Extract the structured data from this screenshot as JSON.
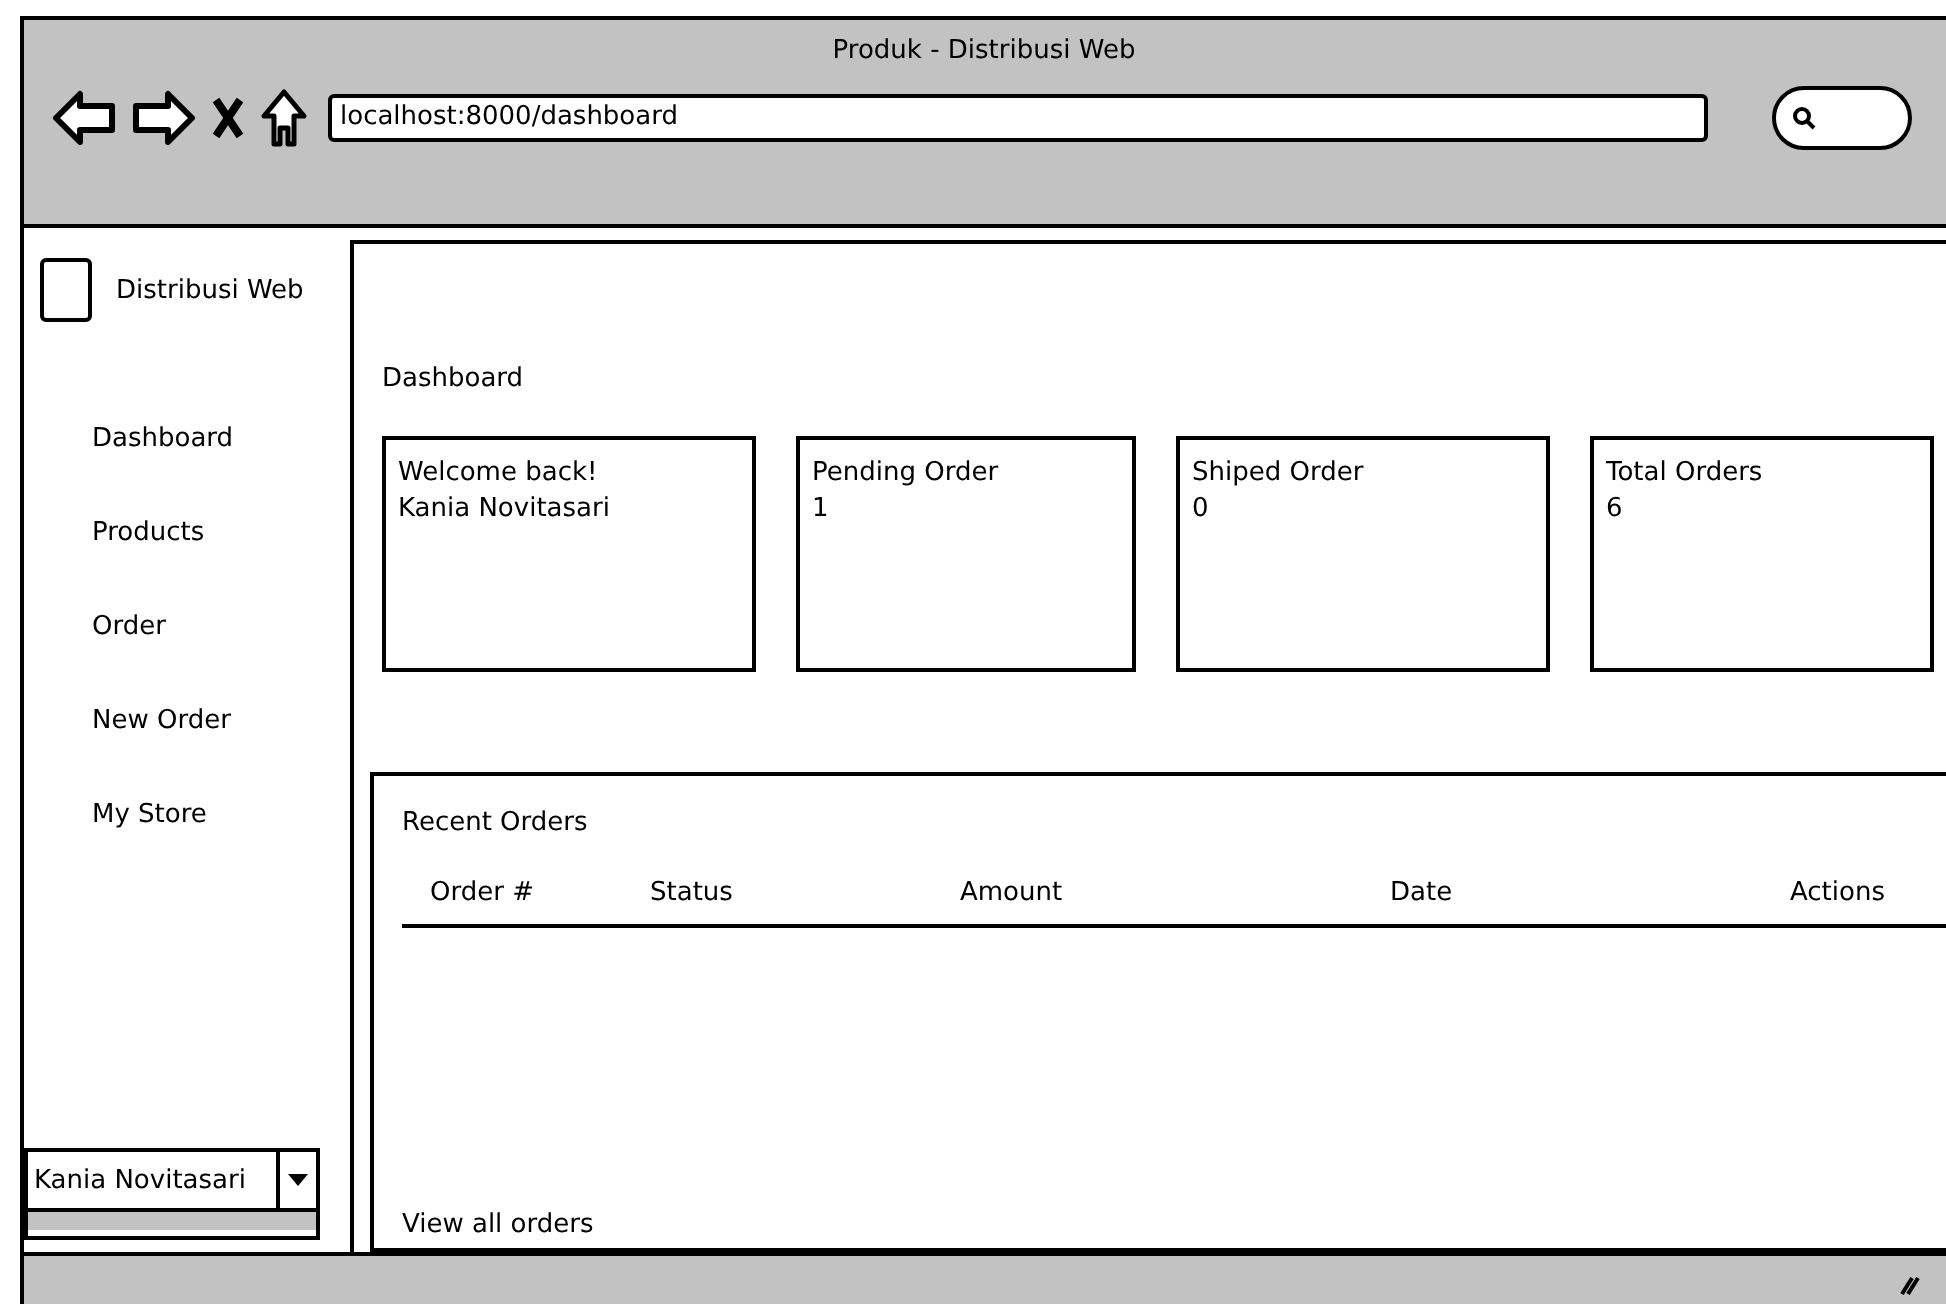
{
  "window": {
    "title": "Produk - Distribusi Web"
  },
  "address_bar": {
    "value": "localhost:8000/dashboard"
  },
  "sidebar": {
    "brand": "Distribusi Web",
    "items": [
      {
        "label": "Dashboard"
      },
      {
        "label": "Products"
      },
      {
        "label": "Order"
      },
      {
        "label": "New Order"
      },
      {
        "label": "My Store"
      }
    ],
    "user_menu": {
      "value": "Kania Novitasari"
    }
  },
  "page_title": "Dashboard",
  "cards": [
    {
      "title": "Welcome back!",
      "value": "Kania Novitasari"
    },
    {
      "title": "Pending Order",
      "value": "1"
    },
    {
      "title": "Shiped Order",
      "value": "0"
    },
    {
      "title": "Total Orders",
      "value": "6"
    }
  ],
  "recent_orders": {
    "title": "Recent Orders",
    "columns": [
      "Order #",
      "Status",
      "Amount",
      "Date",
      "Actions"
    ],
    "link": "View all orders"
  }
}
